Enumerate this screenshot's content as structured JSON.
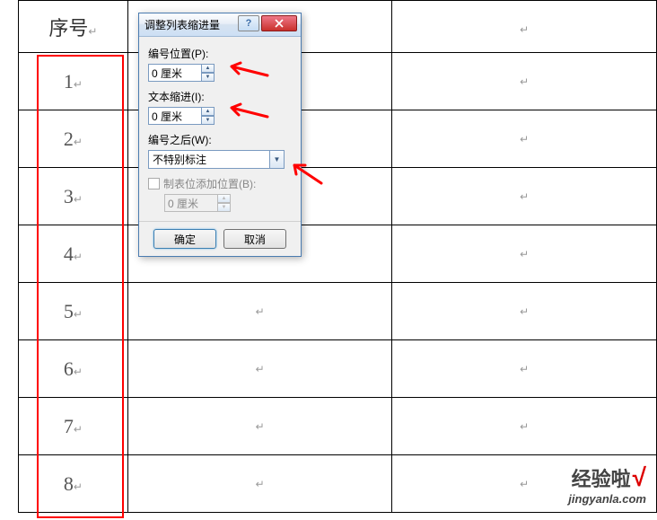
{
  "table": {
    "header": "序号",
    "rows": [
      "1",
      "2",
      "3",
      "4",
      "5",
      "6",
      "7",
      "8"
    ],
    "para_mark": "↵"
  },
  "dialog": {
    "title": "调整列表缩进量",
    "number_pos_label": "编号位置(P):",
    "number_pos_value": "0 厘米",
    "text_indent_label": "文本缩进(I):",
    "text_indent_value": "0 厘米",
    "after_number_label": "编号之后(W):",
    "after_number_value": "不特别标注",
    "tabstop_label": "制表位添加位置(B):",
    "tabstop_value": "0 厘米",
    "ok_label": "确定",
    "cancel_label": "取消",
    "help_label": "?"
  },
  "watermark": {
    "title": "经验啦",
    "check": "√",
    "url": "jingyanla.com"
  }
}
